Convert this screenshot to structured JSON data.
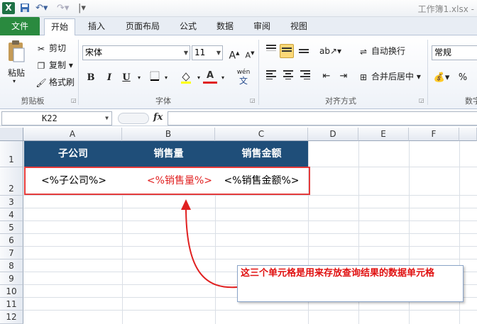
{
  "titlebar": {
    "logo_letter": "X",
    "window_title": "工作簿1.xlsx -"
  },
  "tabs": {
    "file": "文件",
    "items": [
      "开始",
      "插入",
      "页面布局",
      "公式",
      "数据",
      "审阅",
      "视图"
    ],
    "active": "开始"
  },
  "clipboard": {
    "paste": "粘贴",
    "cut": "剪切",
    "copy": "复制",
    "format_painter": "格式刷",
    "group_label": "剪贴板"
  },
  "font": {
    "font_name": "宋体",
    "font_size": "11",
    "bold": "B",
    "italic": "I",
    "underline": "U",
    "font_color_letter": "A",
    "phonetic": "wén",
    "group_label": "字体"
  },
  "alignment": {
    "wrap_text": "自动换行",
    "merge_center": "合并后居中",
    "group_label": "对齐方式"
  },
  "number": {
    "format": "常规",
    "percent": "%",
    "group_label": "数字"
  },
  "formula_bar": {
    "name_box": "K22",
    "fx": "fx",
    "value": ""
  },
  "columns": [
    "A",
    "B",
    "C",
    "D",
    "E",
    "F"
  ],
  "rows": [
    "1",
    "2",
    "3",
    "4",
    "5",
    "6",
    "7",
    "8",
    "9",
    "10",
    "11",
    "12"
  ],
  "sheet": {
    "headers": [
      "子公司",
      "销售量",
      "销售金额"
    ],
    "row2": [
      "<%子公司%>",
      "<%销售量%>",
      "<%销售金额%>"
    ],
    "header_bg": "#1f4e79",
    "highlight_color": "#e53a3a"
  },
  "callout": {
    "text": "这三个单元格是用来存放查询结果的数据单元格"
  }
}
